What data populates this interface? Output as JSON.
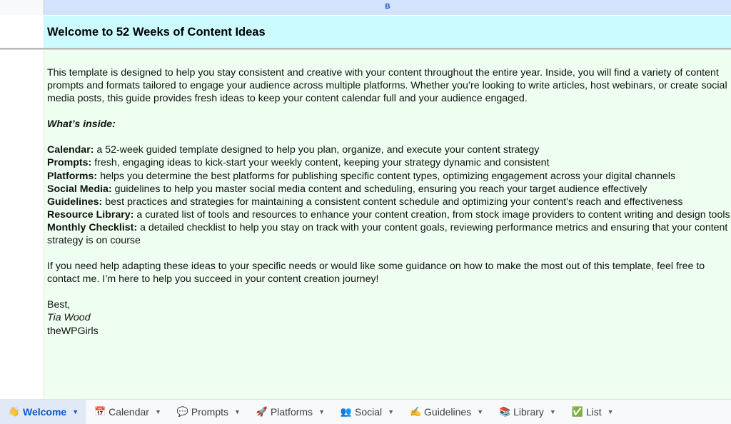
{
  "sheet": {
    "column_label": "B",
    "title": "Welcome to 52 Weeks of Content Ideas"
  },
  "intro": "This template is designed to help you stay consistent and creative with your content throughout the entire year. Inside, you will find a variety of content prompts and formats tailored to engage your audience across multiple platforms. Whether you’re looking to write articles, host webinars, or create social media posts, this guide provides fresh ideas to keep your content calendar full and your audience engaged.",
  "inside_heading": "What’s inside:",
  "items": [
    {
      "label": "Calendar:",
      "text": " a 52-week guided template designed to help you plan, organize, and execute your content strategy"
    },
    {
      "label": "Prompts:",
      "text": " fresh, engaging ideas to kick-start your weekly content, keeping your strategy dynamic and consistent"
    },
    {
      "label": "Platforms:",
      "text": " helps you determine the best platforms for publishing specific content types, optimizing engagement across your digital channels"
    },
    {
      "label": "Social Media:",
      "text": " guidelines to help you master social media content and scheduling, ensuring you reach your target audience effectively"
    },
    {
      "label": "Guidelines:",
      "text": " best practices and strategies for maintaining a consistent content schedule and optimizing your content's reach and effectiveness"
    },
    {
      "label": "Resource Library:",
      "text": " a curated list of tools and resources to enhance your content creation, from stock image providers to content writing and design tools"
    },
    {
      "label": "Monthly Checklist:",
      "text": " a detailed checklist to help you stay on track with your content goals, reviewing performance metrics and ensuring that your content strategy is on course"
    }
  ],
  "closing": "If you need help adapting these ideas to your specific needs or would like some guidance on how to make the most out of this template, feel free to contact me. I’m here to help you succeed in your content creation journey!",
  "signature": {
    "greeting": "Best,",
    "name": "Tia Wood",
    "company": "theWPGirls"
  },
  "tabs": [
    {
      "label": "Welcome",
      "icon": "waving-hand-icon",
      "glyph": "👋",
      "active": true
    },
    {
      "label": "Calendar",
      "icon": "calendar-icon",
      "glyph": "📅",
      "active": false
    },
    {
      "label": "Prompts",
      "icon": "speech-bubble-icon",
      "glyph": "💬",
      "active": false
    },
    {
      "label": "Platforms",
      "icon": "rocket-icon",
      "glyph": "🚀",
      "active": false
    },
    {
      "label": "Social",
      "icon": "people-icon",
      "glyph": "👥",
      "active": false
    },
    {
      "label": "Guidelines",
      "icon": "writing-hand-icon",
      "glyph": "✍",
      "active": false
    },
    {
      "label": "Library",
      "icon": "books-icon",
      "glyph": "📚",
      "active": false
    },
    {
      "label": "List",
      "icon": "check-mark-icon",
      "glyph": "✅",
      "active": false
    }
  ],
  "colors": {
    "title_band": "#ccfbff",
    "content_bg": "#eefff1",
    "active_tab_bg": "#e1e9f7",
    "active_tab_text": "#0b57d0",
    "column_header_selected": "#d3e3fd"
  }
}
